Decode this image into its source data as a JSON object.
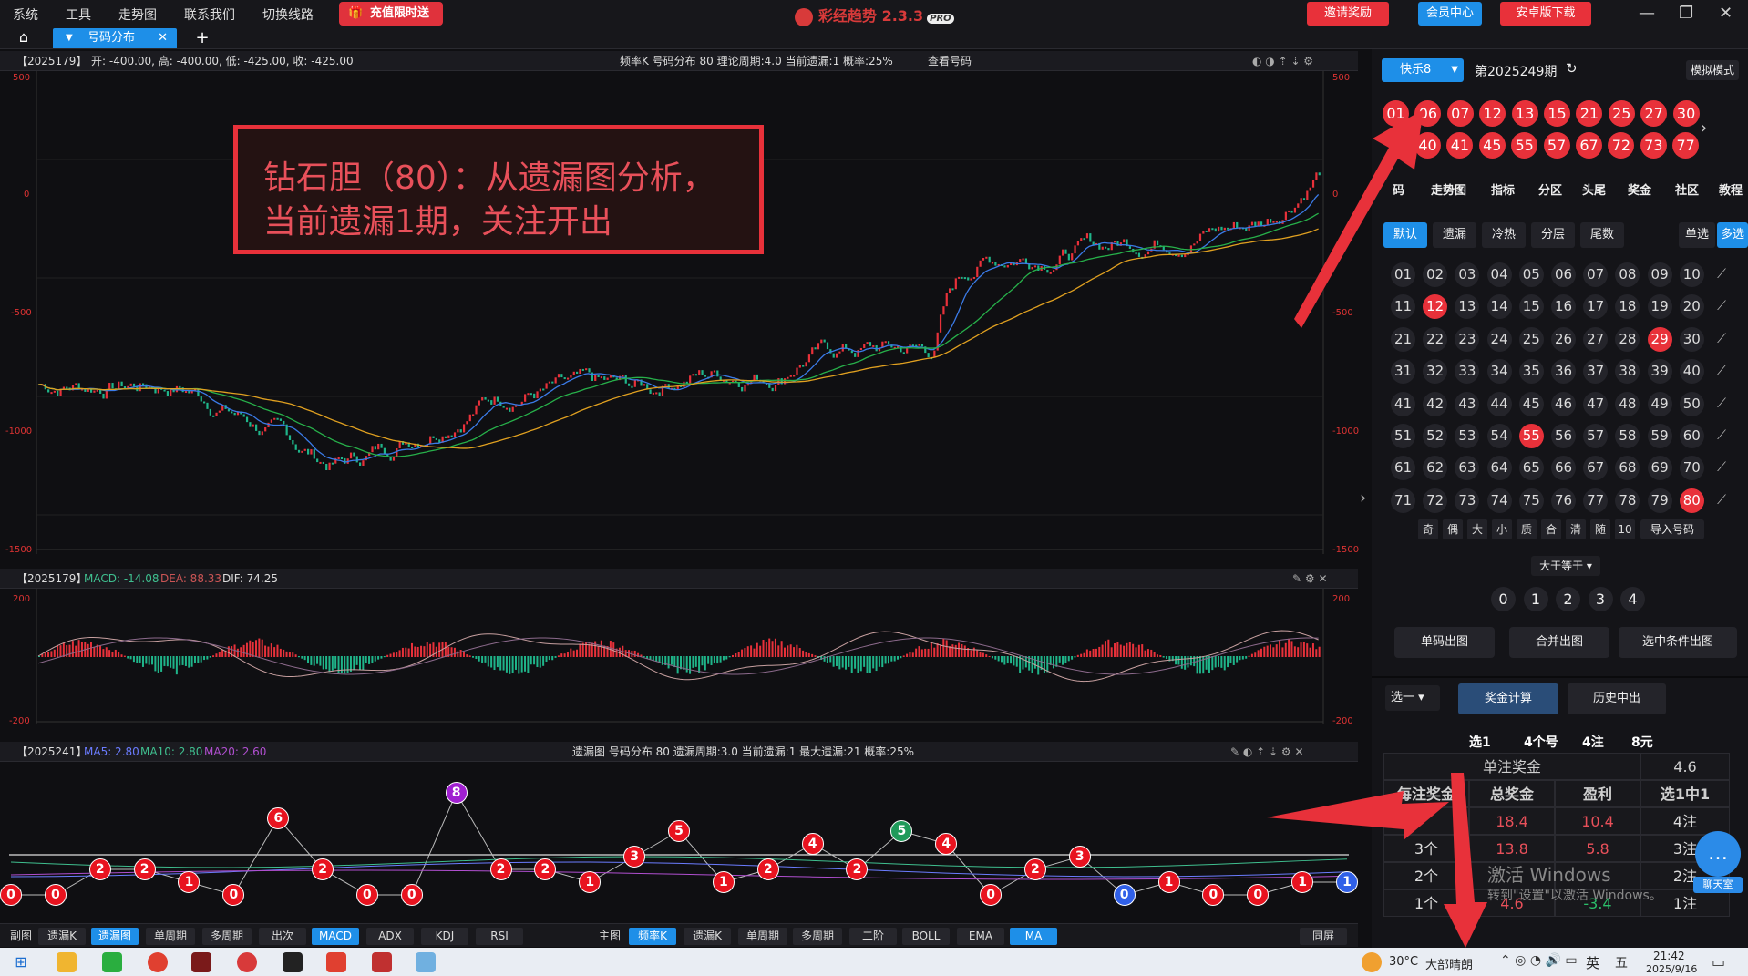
{
  "menu": [
    "系统",
    "工具",
    "走势图",
    "联系我们",
    "切换线路"
  ],
  "promo": "充值限时送",
  "app_title": "彩经趋势 2.3.3",
  "app_badge": "PRO",
  "invite": "邀请奖励",
  "member": "会员中心",
  "android": "安卓版下载",
  "tab": "号码分布",
  "main_head": {
    "period": "【2025179】",
    "ohlc": "开: -400.00, 高: -400.00, 低: -425.00, 收: -425.00",
    "info": "频率K  号码分布  80    理论周期:4.0  当前遗漏:1   概率:25%",
    "query": "查看号码"
  },
  "main_axis": [
    "500",
    "0",
    "-500",
    "-1000",
    "-1500"
  ],
  "annotation": [
    "钻石胆（80）：从遗漏图分析，",
    "当前遗漏1期，关注开出"
  ],
  "macd_head": {
    "period": "【2025179】",
    "macd": "MACD: -14.08",
    "dea": "DEA: 88.33",
    "dif": "DIF: 74.25"
  },
  "macd_axis": [
    "200",
    "0",
    "-200"
  ],
  "omit_head": {
    "period": "【2025241】",
    "ma5": "MA5: 2.80",
    "ma10": "MA10: 2.80",
    "ma20": "MA20: 2.60",
    "info": "遗漏图   号码分布  80    遗漏周期:3.0  当前遗漏:1   最大遗漏:21   概率:25%"
  },
  "omit_values": [
    0,
    0,
    2,
    2,
    1,
    0,
    6,
    2,
    0,
    0,
    8,
    2,
    2,
    1,
    3,
    5,
    1,
    2,
    4,
    2,
    5,
    4,
    0,
    2,
    3,
    0,
    1,
    0,
    0,
    1,
    1
  ],
  "bottom_left": {
    "label": "副图",
    "items": [
      "遗漏K",
      "遗漏图",
      "单周期",
      "多周期",
      "出次",
      "MACD",
      "ADX",
      "KDJ",
      "RSI"
    ]
  },
  "bottom_mid": {
    "label": "主图",
    "items": [
      "频率K",
      "遗漏K",
      "单周期",
      "多周期",
      "二阶",
      "BOLL",
      "EMA",
      "MA"
    ]
  },
  "bottom_right": "同屏",
  "right": {
    "lottery": "快乐8",
    "issue": "第2025249期",
    "sim": "模拟模式",
    "draw_row1": [
      "01",
      "06",
      "07",
      "12",
      "13",
      "15",
      "21",
      "25",
      "27",
      "30"
    ],
    "draw_row2": [
      "40",
      "41",
      "45",
      "55",
      "57",
      "67",
      "72",
      "73",
      "77"
    ],
    "nav": [
      "码",
      "走势图",
      "指标",
      "分区",
      "头尾",
      "奖金",
      "社区",
      "教程"
    ],
    "filters": [
      "默认",
      "遗漏",
      "冷热",
      "分层",
      "尾数"
    ],
    "single": "单选",
    "multi": "多选",
    "selected": [
      "12",
      "29",
      "55",
      "80"
    ],
    "options": [
      "奇",
      "偶",
      "大",
      "小",
      "质",
      "合",
      "清",
      "随",
      "10"
    ],
    "import": "导入号码",
    "ge": "大于等于",
    "counts": [
      "0",
      "1",
      "2",
      "3",
      "4"
    ],
    "actions": [
      "单码出图",
      "合并出图",
      "选中条件出图"
    ],
    "pick": "选一",
    "prize_calc": "奖金计算",
    "history": "历史中出",
    "summary": [
      "选1",
      "4个号",
      "4注",
      "8元"
    ],
    "single_prize_label": "单注奖金",
    "single_prize": "4.6",
    "cols": [
      "每注奖金",
      "总奖金",
      "盈利",
      "选1中1"
    ],
    "rows": [
      [
        "",
        "18.4",
        "10.4",
        "4注"
      ],
      [
        "3个",
        "13.8",
        "5.8",
        "3注"
      ],
      [
        "2个",
        "",
        "",
        "2注"
      ],
      [
        "1个",
        "4.6",
        "-3.4",
        "1注"
      ]
    ],
    "activate1": "激活 Windows",
    "activate2": "转到\"设置\"以激活 Windows。",
    "chat": "聊天室"
  },
  "taskbar": {
    "temp": "30°C",
    "weather": "大部晴朗",
    "ime": "英",
    "time": "21:42",
    "date": "2025/9/16"
  }
}
